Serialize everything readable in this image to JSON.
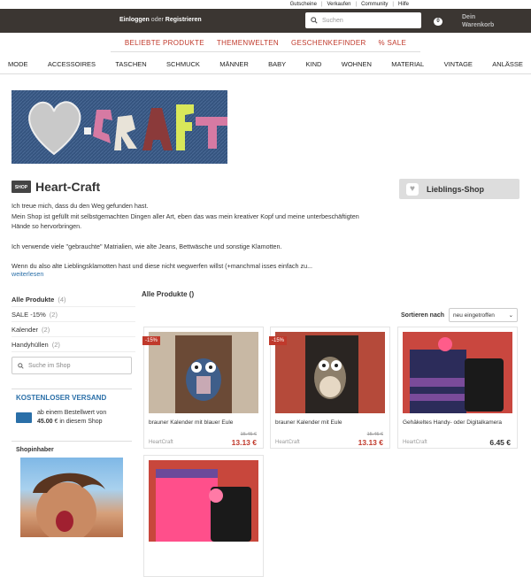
{
  "top_links": [
    "Gutscheine",
    "Verkaufen",
    "Community",
    "Hilfe"
  ],
  "header": {
    "login": "Einloggen",
    "or": "oder",
    "register": "Registrieren",
    "search_placeholder": "Suchen",
    "cart_count": "0",
    "cart_line1": "Dein",
    "cart_line2": "Warenkorb"
  },
  "promo_nav": [
    "BELIEBTE PRODUKTE",
    "THEMENWELTEN",
    "GESCHENKEFINDER",
    "% SALE"
  ],
  "category_nav": [
    "MODE",
    "ACCESSOIRES",
    "TASCHEN",
    "SCHMUCK",
    "MÄNNER",
    "BABY",
    "KIND",
    "WOHNEN",
    "MATERIAL",
    "VINTAGE",
    "ANLÄSSE"
  ],
  "shop": {
    "icon_text": "SHOP",
    "name": "Heart-Craft",
    "favorite_label": "Lieblings-Shop",
    "description": [
      "Ich treue mich, dass du den Weg gefunden hast.",
      "Mein Shop ist gefüllt mit selbstgemachten Dingen aller Art, eben das was mein kreativer Kopf und meine unterbeschäftigten Hände so hervorbringen.",
      "Ich verwende viele \"gebrauchte\" Matrialien, wie alte Jeans, Bettwäsche und sonstige Klamotten.",
      "Wenn du also alte Lieblingsklamotten hast und diese nicht wegwerfen willst (+manchmal isses einfach zu..."
    ],
    "read_more": "weiterlesen"
  },
  "sidebar": {
    "categories": [
      {
        "label": "Alle Produkte",
        "count": "(4)"
      },
      {
        "label": "SALE -15%",
        "count": "(2)"
      },
      {
        "label": "Kalender",
        "count": "(2)"
      },
      {
        "label": "Handyhüllen",
        "count": "(2)"
      }
    ],
    "search_placeholder": "Suche im Shop",
    "shipping_title": "KOSTENLOSER VERSAND",
    "shipping_line1": "ab einem Bestellwert von",
    "shipping_amount": "45.00",
    "shipping_line2": "€  in diesem Shop",
    "owner_title": "Shopinhaber"
  },
  "main": {
    "heading": "Alle Produkte ()",
    "sort_label": "Sortieren nach",
    "sort_value": "neu eingetroffen"
  },
  "products": [
    {
      "badge": "-15%",
      "title": "brauner Kalender mit blauer Eule",
      "shop": "HeartCraft",
      "old_price": "15.45 €",
      "price": "13.13 €"
    },
    {
      "badge": "-15%",
      "title": "brauner Kalender mit Eule",
      "shop": "HeartCraft",
      "old_price": "15.45 €",
      "price": "13.13 €"
    },
    {
      "badge": "",
      "title": "Gehäkeltes Handy- oder Digitalkamera",
      "shop": "HeartCraft",
      "old_price": "",
      "price": "6.45 €"
    },
    {
      "badge": "",
      "title": "",
      "shop": "",
      "old_price": "",
      "price": ""
    }
  ],
  "colors": {
    "topbar": "#3b3632",
    "accent_red": "#c0392b",
    "link_blue": "#2a6fa8"
  }
}
